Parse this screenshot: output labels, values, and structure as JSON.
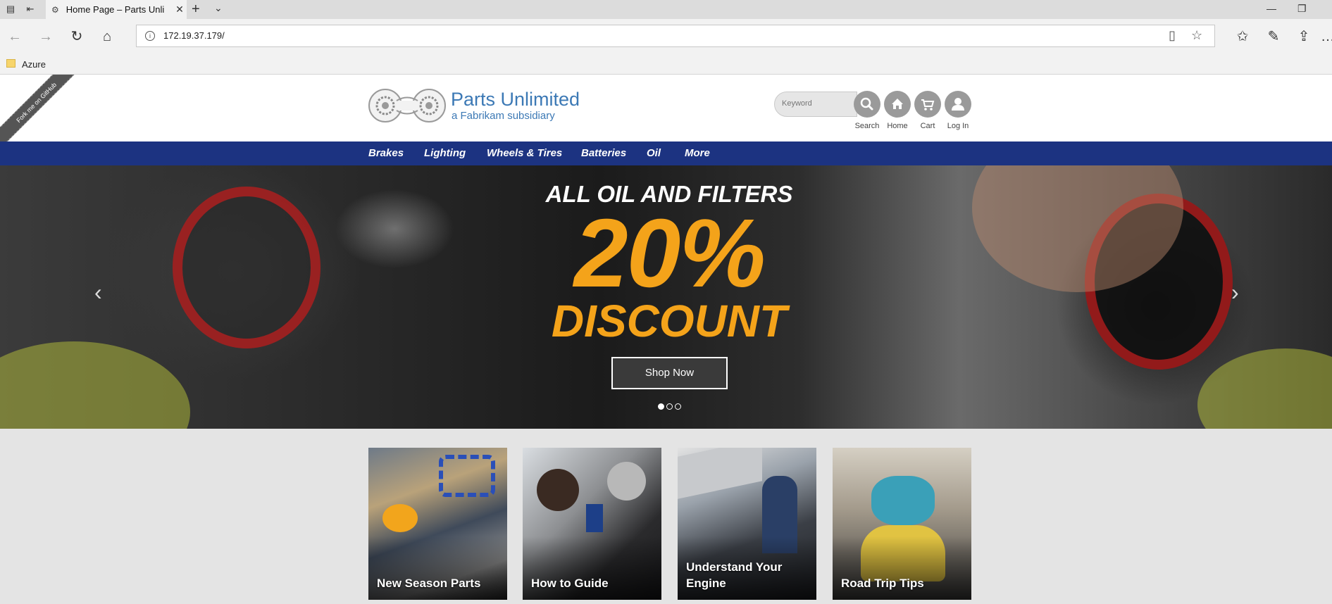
{
  "browser": {
    "tab_title": "Home Page – Parts Unli",
    "url": "172.19.37.179/",
    "favorites": [
      {
        "label": "Azure",
        "icon": "folder-icon"
      }
    ]
  },
  "site": {
    "brand_name": "Parts Unlimited",
    "brand_sub": "a Fabrikam subsidiary",
    "github_ribbon": "Fork me on GitHub",
    "search_placeholder": "Keyword",
    "header_buttons": [
      {
        "label": "Search",
        "icon": "search-icon"
      },
      {
        "label": "Home",
        "icon": "home-icon"
      },
      {
        "label": "Cart",
        "icon": "cart-icon"
      },
      {
        "label": "Log In",
        "icon": "user-icon"
      }
    ],
    "categories": [
      "Brakes",
      "Lighting",
      "Wheels & Tires",
      "Batteries",
      "Oil",
      "More"
    ],
    "colors": {
      "brand": "#3c79b5",
      "nav": "#1c3381",
      "promo": "#f4a31a"
    }
  },
  "hero": {
    "line1": "ALL OIL AND FILTERS",
    "percent": "20%",
    "line2": "DISCOUNT",
    "cta": "Shop Now",
    "slide_count": 3,
    "active_slide": 1
  },
  "tiles": [
    {
      "caption": "New Season Parts"
    },
    {
      "caption": "How to Guide"
    },
    {
      "caption": "Understand Your Engine"
    },
    {
      "caption": "Road Trip Tips"
    }
  ]
}
